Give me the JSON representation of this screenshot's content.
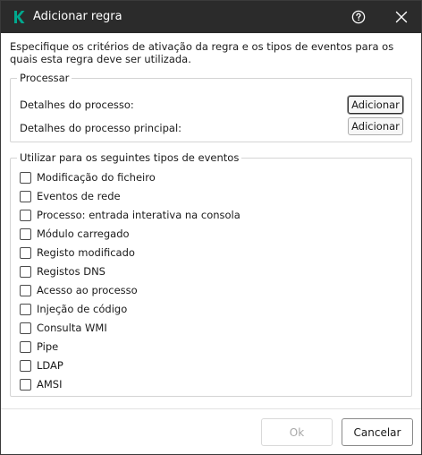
{
  "window": {
    "title": "Adicionar regra",
    "logo_icon": "kaspersky-k-icon",
    "help_icon": "help-circle-icon",
    "close_icon": "close-icon",
    "accent_color": "#00a88e"
  },
  "intro": "Especifique os critérios de ativação da regra e os tipos de eventos para os quais esta regra deve ser utilizada.",
  "process": {
    "legend": "Processar",
    "rows": [
      {
        "label": "Detalhes do processo:",
        "button": "Adicionar"
      },
      {
        "label": "Detalhes do processo principal:",
        "button": "Adicionar"
      }
    ]
  },
  "events": {
    "legend": "Utilizar para os seguintes tipos de eventos",
    "items": [
      {
        "label": "Modificação do ficheiro",
        "checked": false
      },
      {
        "label": "Eventos de rede",
        "checked": false
      },
      {
        "label": "Processo: entrada interativa na consola",
        "checked": false
      },
      {
        "label": "Módulo carregado",
        "checked": false
      },
      {
        "label": "Registo modificado",
        "checked": false
      },
      {
        "label": "Registos DNS",
        "checked": false
      },
      {
        "label": "Acesso ao processo",
        "checked": false
      },
      {
        "label": "Injeção de código",
        "checked": false
      },
      {
        "label": "Consulta WMI",
        "checked": false
      },
      {
        "label": "Pipe",
        "checked": false
      },
      {
        "label": "LDAP",
        "checked": false
      },
      {
        "label": "AMSI",
        "checked": false
      }
    ]
  },
  "footer": {
    "ok_label": "Ok",
    "ok_enabled": false,
    "cancel_label": "Cancelar"
  }
}
